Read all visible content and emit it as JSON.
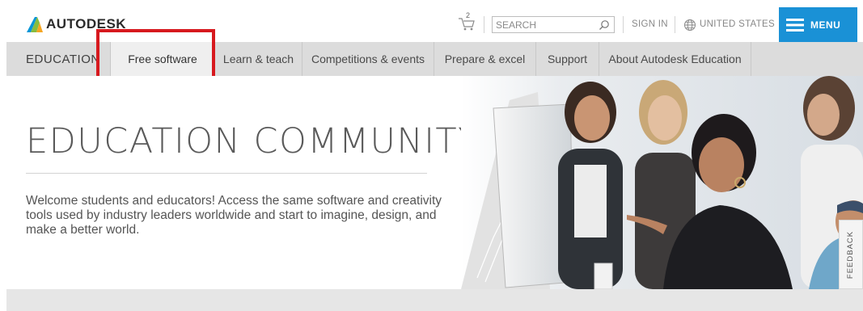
{
  "header": {
    "brand_name": "AUTODESK",
    "cart_count": "2",
    "search_placeholder": "SEARCH",
    "sign_in": "SIGN IN",
    "country": "UNITED STATES",
    "menu_label": "MENU",
    "accent_color": "#1a91d6"
  },
  "nav": {
    "section_label": "EDUCATION",
    "items": [
      {
        "label": "Free software",
        "active": true
      },
      {
        "label": "Learn & teach"
      },
      {
        "label": "Competitions & events"
      },
      {
        "label": "Prepare & excel"
      },
      {
        "label": "Support"
      },
      {
        "label": "About Autodesk Education"
      }
    ],
    "highlight_color": "#d7191e"
  },
  "hero": {
    "title": "EDUCATION COMMUNITY",
    "copy": "Welcome students and educators! Access the same software and creativity tools used by industry leaders worldwide and start to imagine, design, and make a better world."
  },
  "feedback_label": "FEEDBACK",
  "icons": [
    "autodesk-logo-icon",
    "cart-icon",
    "search-icon",
    "globe-icon",
    "hamburger-icon"
  ]
}
